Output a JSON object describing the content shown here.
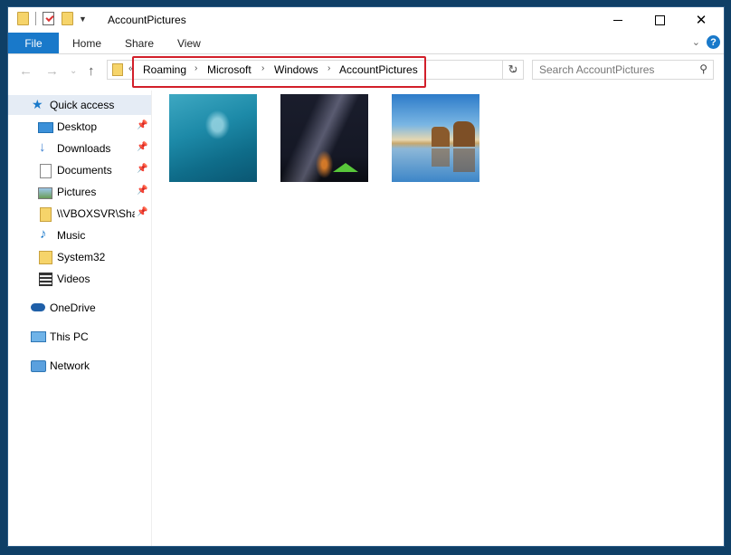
{
  "window": {
    "title": "AccountPictures",
    "controls": {
      "minimize": "",
      "maximize": "",
      "close": "✕"
    }
  },
  "ribbon": {
    "tabs": [
      {
        "label": "File"
      },
      {
        "label": "Home"
      },
      {
        "label": "Share"
      },
      {
        "label": "View"
      }
    ],
    "help": "?"
  },
  "address": {
    "overflow": "«",
    "crumbs": [
      "Roaming",
      "Microsoft",
      "Windows",
      "AccountPictures"
    ],
    "separator": "›"
  },
  "search": {
    "placeholder": "Search AccountPictures"
  },
  "sidebar": {
    "items": [
      {
        "label": "Quick access",
        "icon": "star-icon"
      },
      {
        "label": "Desktop",
        "icon": "desktop-icon",
        "pinned": true
      },
      {
        "label": "Downloads",
        "icon": "download-icon",
        "pinned": true
      },
      {
        "label": "Documents",
        "icon": "document-icon",
        "pinned": true
      },
      {
        "label": "Pictures",
        "icon": "pictures-icon",
        "pinned": true
      },
      {
        "label": "\\\\VBOXSVR\\Shar",
        "icon": "network-share-icon",
        "pinned": true
      },
      {
        "label": "Music",
        "icon": "music-icon"
      },
      {
        "label": "System32",
        "icon": "folder-icon"
      },
      {
        "label": "Videos",
        "icon": "video-icon"
      },
      {
        "label": "OneDrive",
        "icon": "onedrive-icon"
      },
      {
        "label": "This PC",
        "icon": "pc-icon"
      },
      {
        "label": "Network",
        "icon": "network-icon"
      }
    ]
  },
  "files": [
    {
      "kind": "image",
      "description_icon": "underwater-thumbnail"
    },
    {
      "kind": "image",
      "description_icon": "night-sky-thumbnail"
    },
    {
      "kind": "image",
      "description_icon": "beach-rocks-thumbnail"
    }
  ],
  "colors": {
    "accent": "#1979ca",
    "highlight": "#d21f2a",
    "selected_bg": "#e5ecf5"
  }
}
